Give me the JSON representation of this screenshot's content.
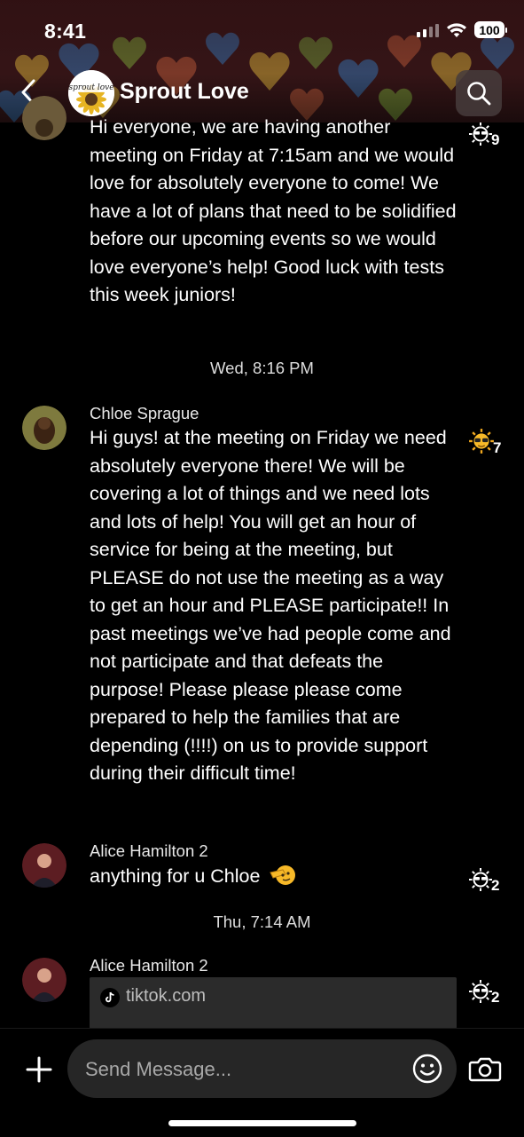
{
  "status_bar": {
    "time": "8:41",
    "battery": "100"
  },
  "header": {
    "group_name": "Sprout Love",
    "logo_text": "sprout love"
  },
  "messages": [
    {
      "text": "Hi everyone, we are having another meeting on Friday at 7:15am and we would love for absolutely everyone to come! We have a lot of plans that need to be solidified before our upcoming events so we would love everyone’s help! Good luck with tests this week juniors!",
      "reaction_count": "9"
    },
    {
      "sender": "Chloe Sprague",
      "text": "Hi guys! at the meeting on Friday we need absolutely everyone there! We will be covering a lot of things and we need lots and lots of help! You will get an hour of service for being at the meeting, but PLEASE do not use the meeting as a way to get an hour and PLEASE participate!! In past meetings we’ve had people come and not participate and that defeats the purpose! Please please please come prepared to help the families that are depending (!!!!) on us to provide support during their difficult time!",
      "reaction_count": "7"
    },
    {
      "sender": "Alice Hamilton 2",
      "text": "anything for u Chloe",
      "reaction_count": "2"
    },
    {
      "sender": "Alice Hamilton 2",
      "link": "tiktok.com",
      "reaction_count": "2"
    }
  ],
  "separators": [
    "Wed, 8:16 PM",
    "Thu, 7:14 AM"
  ],
  "composer": {
    "placeholder": "Send Message..."
  },
  "icons": [
    "back-chevron-icon",
    "search-icon",
    "sunglasses-sun-icon",
    "salute-emoji-icon",
    "tiktok-icon",
    "plus-icon",
    "smiley-icon",
    "camera-icon"
  ]
}
